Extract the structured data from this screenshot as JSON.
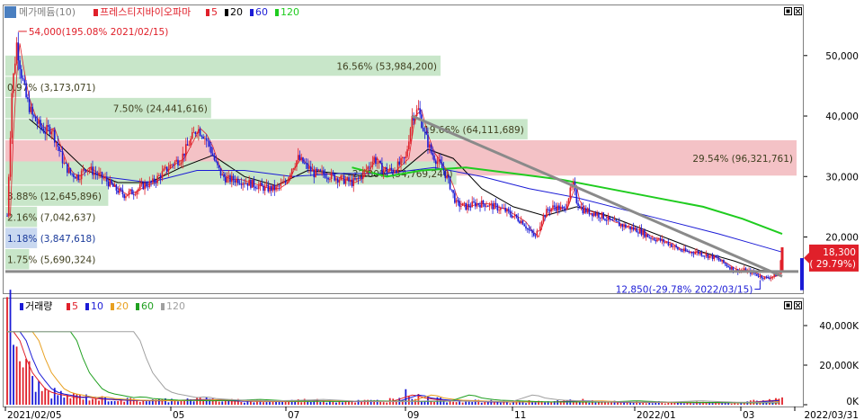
{
  "window": {
    "price_panel_title": "메가메듐(10)",
    "stock_name": "프레스티지바이오파마",
    "price_legend": [
      {
        "label": "5",
        "color": "#e0202a"
      },
      {
        "label": "20",
        "color": "#000000"
      },
      {
        "label": "60",
        "color": "#1b1bd6"
      },
      {
        "label": "120",
        "color": "#1fcc1f"
      }
    ],
    "volume_panel_title": "거래량",
    "volume_legend": [
      {
        "label": "5",
        "color": "#e0202a"
      },
      {
        "label": "10",
        "color": "#1b1bd6"
      },
      {
        "label": "20",
        "color": "#e8a020"
      },
      {
        "label": "60",
        "color": "#20a020"
      },
      {
        "label": "120",
        "color": "#a0a0a0"
      }
    ],
    "panel_icons": [
      "maximize-icon",
      "close-icon"
    ]
  },
  "chart_data": {
    "type": "candlestick",
    "x_ticks": [
      "2021/02/05",
      "05",
      "07",
      "09",
      "11",
      "2022/01",
      "03",
      "2022/03/31"
    ],
    "price_axis": {
      "ticks": [
        "50,000",
        "40,000",
        "30,000",
        "20,000"
      ],
      "ylim": [
        11000,
        58000
      ]
    },
    "volume_axis": {
      "ticks": [
        "40,000K",
        "20,000K",
        "0K"
      ],
      "ylim": [
        0,
        50000
      ]
    },
    "annotations": {
      "high": {
        "text": "54,000(195.08% 2021/02/15)",
        "value": 54000
      },
      "low": {
        "text": "12,850(-29.78% 2022/03/15)",
        "value": 12850
      },
      "current": {
        "value_text": "18,300",
        "pct_text": "( 29.79%)",
        "value": 18300
      }
    },
    "volume_profile": [
      {
        "text": "16.56% (53,984,200)",
        "from": 46500,
        "to": 50000,
        "color": "green",
        "frac": 0.55
      },
      {
        "text": "0.97% (3,173,071)",
        "from": 43000,
        "to": 46500,
        "color": "green",
        "frac": 0.02
      },
      {
        "text": "7.50% (24,441,616)",
        "from": 39500,
        "to": 43000,
        "color": "green",
        "frac": 0.26
      },
      {
        "text": "19.66% (64,111,689)",
        "from": 36000,
        "to": 39500,
        "color": "green",
        "frac": 0.66
      },
      {
        "text": "29.54% (96,321,761)",
        "from": 30000,
        "to": 36000,
        "color": "red",
        "frac": 1.0
      },
      {
        "text": "22.00% (54,769,240)",
        "from": 28500,
        "to": 32500,
        "color": "green",
        "frac": 0.57
      },
      {
        "text": "3.88% (12,645,896)",
        "from": 25000,
        "to": 28500,
        "color": "green",
        "frac": 0.13
      },
      {
        "text": "2.16% (7,042,637)",
        "from": 21500,
        "to": 25000,
        "color": "green",
        "frac": 0.04
      },
      {
        "text": "1.18% (3,847,618)",
        "from": 18000,
        "to": 21500,
        "color": "blue",
        "frac": 0.04
      },
      {
        "text": "1.75% (5,690,324)",
        "from": 14500,
        "to": 18000,
        "color": "green",
        "frac": 0.03
      }
    ],
    "close_path": [
      [
        0,
        23500
      ],
      [
        3,
        44000
      ],
      [
        6,
        52000
      ],
      [
        9,
        47000
      ],
      [
        12,
        43000
      ],
      [
        16,
        40000
      ],
      [
        20,
        38500
      ],
      [
        24,
        37500
      ],
      [
        28,
        38000
      ],
      [
        32,
        35000
      ],
      [
        36,
        32000
      ],
      [
        40,
        30500
      ],
      [
        45,
        30000
      ],
      [
        50,
        31500
      ],
      [
        56,
        30500
      ],
      [
        62,
        29500
      ],
      [
        68,
        28000
      ],
      [
        74,
        27000
      ],
      [
        80,
        27500
      ],
      [
        86,
        28500
      ],
      [
        92,
        29000
      ],
      [
        98,
        30500
      ],
      [
        104,
        32000
      ],
      [
        110,
        33000
      ],
      [
        116,
        36000
      ],
      [
        120,
        38000
      ],
      [
        124,
        37000
      ],
      [
        128,
        35000
      ],
      [
        132,
        32000
      ],
      [
        136,
        30000
      ],
      [
        140,
        29500
      ],
      [
        146,
        29500
      ],
      [
        152,
        29000
      ],
      [
        158,
        28500
      ],
      [
        164,
        28000
      ],
      [
        170,
        28000
      ],
      [
        176,
        29000
      ],
      [
        180,
        31500
      ],
      [
        184,
        33000
      ],
      [
        188,
        32000
      ],
      [
        194,
        30500
      ],
      [
        200,
        30500
      ],
      [
        206,
        30000
      ],
      [
        212,
        29500
      ],
      [
        218,
        29000
      ],
      [
        222,
        29500
      ],
      [
        228,
        31500
      ],
      [
        232,
        33000
      ],
      [
        236,
        31500
      ],
      [
        240,
        31000
      ],
      [
        244,
        31000
      ],
      [
        248,
        32000
      ],
      [
        252,
        33000
      ],
      [
        256,
        40000
      ],
      [
        260,
        41000
      ],
      [
        264,
        37000
      ],
      [
        268,
        34000
      ],
      [
        272,
        32500
      ],
      [
        276,
        31000
      ],
      [
        280,
        28500
      ],
      [
        284,
        25500
      ],
      [
        290,
        25000
      ],
      [
        296,
        25500
      ],
      [
        302,
        25500
      ],
      [
        308,
        25000
      ],
      [
        314,
        24500
      ],
      [
        320,
        23500
      ],
      [
        326,
        22500
      ],
      [
        330,
        21000
      ],
      [
        334,
        20000
      ],
      [
        338,
        23000
      ],
      [
        342,
        24500
      ],
      [
        346,
        25000
      ],
      [
        352,
        24500
      ],
      [
        356,
        27500
      ],
      [
        358,
        28500
      ],
      [
        360,
        26000
      ],
      [
        364,
        24500
      ],
      [
        370,
        24000
      ],
      [
        376,
        23500
      ],
      [
        382,
        22500
      ],
      [
        388,
        22000
      ],
      [
        394,
        21500
      ],
      [
        400,
        21000
      ],
      [
        406,
        20000
      ],
      [
        412,
        19500
      ],
      [
        418,
        19000
      ],
      [
        424,
        18000
      ],
      [
        430,
        17500
      ],
      [
        436,
        17500
      ],
      [
        442,
        17000
      ],
      [
        448,
        16500
      ],
      [
        454,
        15500
      ],
      [
        460,
        14500
      ],
      [
        466,
        14500
      ],
      [
        472,
        14000
      ],
      [
        476,
        13500
      ],
      [
        480,
        13200
      ],
      [
        484,
        13500
      ],
      [
        488,
        14000
      ],
      [
        490,
        18300
      ]
    ],
    "n_days": 491,
    "trendline": {
      "from": [
        256,
        40000
      ],
      "to": [
        490,
        13500
      ]
    },
    "support_line": 14300,
    "ma": {
      "20": [
        [
          14,
          39500
        ],
        [
          30,
          36000
        ],
        [
          50,
          31000
        ],
        [
          70,
          29000
        ],
        [
          90,
          29000
        ],
        [
          110,
          31500
        ],
        [
          130,
          33500
        ],
        [
          150,
          30000
        ],
        [
          170,
          28500
        ],
        [
          190,
          31000
        ],
        [
          210,
          30500
        ],
        [
          230,
          30000
        ],
        [
          250,
          31000
        ],
        [
          266,
          34500
        ],
        [
          282,
          33000
        ],
        [
          300,
          28000
        ],
        [
          320,
          25000
        ],
        [
          340,
          23500
        ],
        [
          360,
          25000
        ],
        [
          380,
          23500
        ],
        [
          400,
          21500
        ],
        [
          420,
          19500
        ],
        [
          440,
          17500
        ],
        [
          460,
          16000
        ],
        [
          476,
          14500
        ],
        [
          490,
          14300
        ]
      ],
      "60": [
        [
          60,
          30000
        ],
        [
          90,
          29000
        ],
        [
          120,
          31000
        ],
        [
          150,
          31000
        ],
        [
          180,
          30000
        ],
        [
          210,
          30500
        ],
        [
          240,
          30500
        ],
        [
          270,
          31500
        ],
        [
          300,
          30000
        ],
        [
          330,
          28000
        ],
        [
          360,
          26500
        ],
        [
          390,
          24500
        ],
        [
          420,
          22500
        ],
        [
          450,
          20500
        ],
        [
          470,
          19000
        ],
        [
          490,
          17500
        ]
      ],
      "120": [
        [
          218,
          31500
        ],
        [
          240,
          30000
        ],
        [
          262,
          31000
        ],
        [
          290,
          31500
        ],
        [
          320,
          30500
        ],
        [
          350,
          29500
        ],
        [
          380,
          28000
        ],
        [
          410,
          26500
        ],
        [
          440,
          25000
        ],
        [
          465,
          23000
        ],
        [
          490,
          20500
        ]
      ]
    },
    "volume_sample": [
      [
        2,
        41000
      ],
      [
        4,
        36000
      ],
      [
        6,
        30000
      ],
      [
        8,
        26000
      ],
      [
        10,
        22000
      ],
      [
        12,
        18000
      ],
      [
        14,
        16000
      ],
      [
        17,
        12000
      ],
      [
        20,
        9000
      ],
      [
        24,
        7000
      ],
      [
        28,
        6000
      ],
      [
        34,
        5000
      ],
      [
        40,
        4000
      ],
      [
        46,
        4500
      ],
      [
        52,
        3500
      ],
      [
        60,
        3000
      ],
      [
        70,
        2500
      ],
      [
        90,
        2200
      ],
      [
        110,
        2600
      ],
      [
        120,
        3000
      ],
      [
        140,
        2000
      ],
      [
        170,
        1800
      ],
      [
        190,
        2200
      ],
      [
        220,
        1800
      ],
      [
        240,
        2000
      ],
      [
        254,
        6000
      ],
      [
        258,
        4000
      ],
      [
        270,
        2600
      ],
      [
        300,
        1600
      ],
      [
        340,
        1500
      ],
      [
        358,
        2200
      ],
      [
        380,
        1400
      ],
      [
        420,
        1200
      ],
      [
        460,
        1000
      ],
      [
        490,
        3000
      ]
    ]
  }
}
